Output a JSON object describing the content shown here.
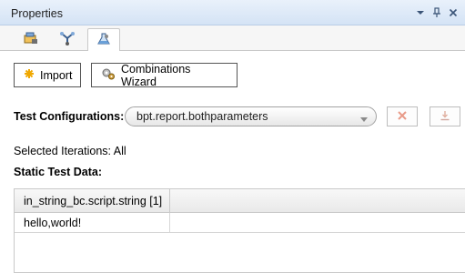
{
  "panel": {
    "title": "Properties",
    "tabs": [
      {
        "icon": "general-properties-icon"
      },
      {
        "icon": "parameters-icon"
      },
      {
        "icon": "test-data-icon"
      }
    ]
  },
  "toolbar": {
    "import_label": "Import",
    "wizard_label": "Combinations Wizard"
  },
  "test_config": {
    "label": "Test Configurations:",
    "selected": "bpt.report.bothparameters"
  },
  "iterations": {
    "label": "Selected Iterations: All"
  },
  "static_data": {
    "label": "Static Test Data:",
    "columns": [
      "in_string_bc.script.string [1]",
      ""
    ],
    "rows": [
      [
        "hello,world!",
        ""
      ]
    ]
  },
  "colors": {
    "titlebar": "#d4e3f5",
    "delete_icon": "#e06040",
    "import_star": "#f0a800"
  }
}
